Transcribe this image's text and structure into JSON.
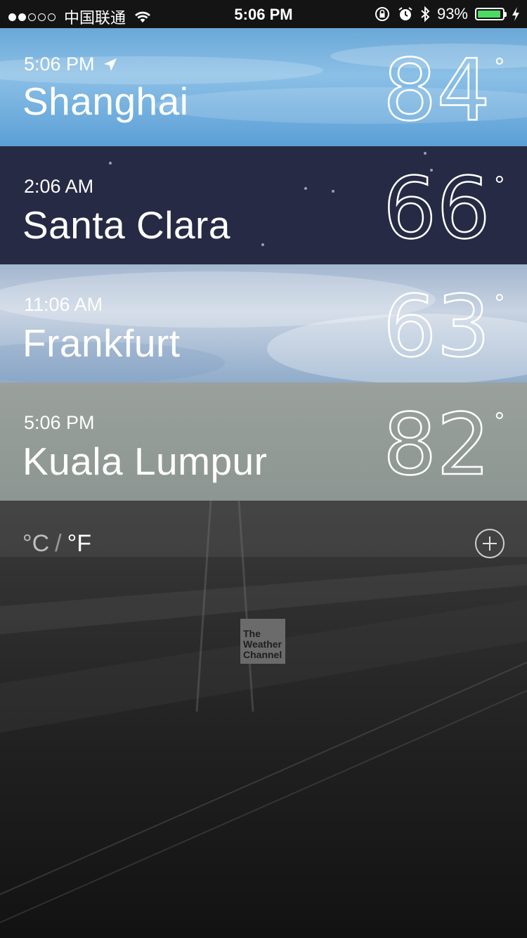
{
  "status_bar": {
    "carrier": "中国联通",
    "time": "5:06 PM",
    "battery_percent": "93%",
    "battery_level": 0.93,
    "signal_bars_filled": 2,
    "signal_bars_total": 5,
    "icons": [
      "wifi-icon",
      "rotation-lock-icon",
      "alarm-icon",
      "bluetooth-icon",
      "charging-bolt-icon"
    ]
  },
  "cities": [
    {
      "time": "5:06 PM",
      "name": "Shanghai",
      "temp": "84",
      "degree": "°",
      "has_location_icon": true
    },
    {
      "time": "2:06 AM",
      "name": "Santa Clara",
      "temp": "66",
      "degree": "°",
      "has_location_icon": false
    },
    {
      "time": "11:06 AM",
      "name": "Frankfurt",
      "temp": "63",
      "degree": "°",
      "has_location_icon": false
    },
    {
      "time": "5:06 PM",
      "name": "Kuala Lumpur",
      "temp": "82",
      "degree": "°",
      "has_location_icon": false
    }
  ],
  "units": {
    "celsius": "°C",
    "slash": "/",
    "fahrenheit": "°F",
    "active": "fahrenheit"
  },
  "logo": {
    "line1": "The",
    "line2": "Weather",
    "line3": "Channel"
  },
  "colors": {
    "battery": "#4cd964",
    "santa_clara_bg": "#262a44"
  }
}
